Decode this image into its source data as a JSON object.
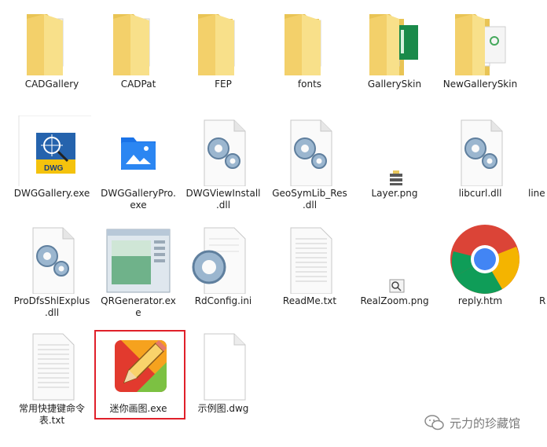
{
  "files": [
    {
      "label": "CADGallery",
      "icon": "folder-icon"
    },
    {
      "label": "CADPat",
      "icon": "folder-icon"
    },
    {
      "label": "FEP",
      "icon": "folder-icon"
    },
    {
      "label": "fonts",
      "icon": "folder-icon"
    },
    {
      "label": "GallerySkin",
      "icon": "folder-icon"
    },
    {
      "label": "NewGallerySkin",
      "icon": "folder-icon"
    },
    {
      "label": "DWGGallery.exe",
      "icon": "dwg-app-icon"
    },
    {
      "label": "DWGGalleryPro.\nexe",
      "icon": "photo-app-icon"
    },
    {
      "label": "DWGViewInstall\n.dll",
      "icon": "dll-gear-icon"
    },
    {
      "label": "GeoSymLib_Res\n.dll",
      "icon": "dll-gear-icon"
    },
    {
      "label": "Layer.png",
      "icon": "layer-png-icon"
    },
    {
      "label": "libcurl.dll",
      "icon": "dll-gear-icon"
    },
    {
      "label": "line",
      "icon": "partial-file-icon"
    },
    {
      "label": "ProDfsShlExplus\n.dll",
      "icon": "dll-gear-icon"
    },
    {
      "label": "QRGenerator.ex\ne",
      "icon": "window-app-icon"
    },
    {
      "label": "RdConfig.ini",
      "icon": "ini-gear-icon"
    },
    {
      "label": "ReadMe.txt",
      "icon": "text-file-icon"
    },
    {
      "label": "RealZoom.png",
      "icon": "zoom-png-icon"
    },
    {
      "label": "reply.htm",
      "icon": "chrome-icon"
    },
    {
      "label": "R",
      "icon": "partial-file-icon"
    },
    {
      "label": "常用快捷键命令\n表.txt",
      "icon": "text-file-icon"
    },
    {
      "label": "迷你画图.exe",
      "icon": "paint-app-icon"
    },
    {
      "label": "示例图.dwg",
      "icon": "blank-file-icon"
    }
  ],
  "watermark": {
    "text": "元力的珍藏馆"
  },
  "colors": {
    "selection_frame": "#e0202a",
    "folder": "#f5d66e"
  }
}
